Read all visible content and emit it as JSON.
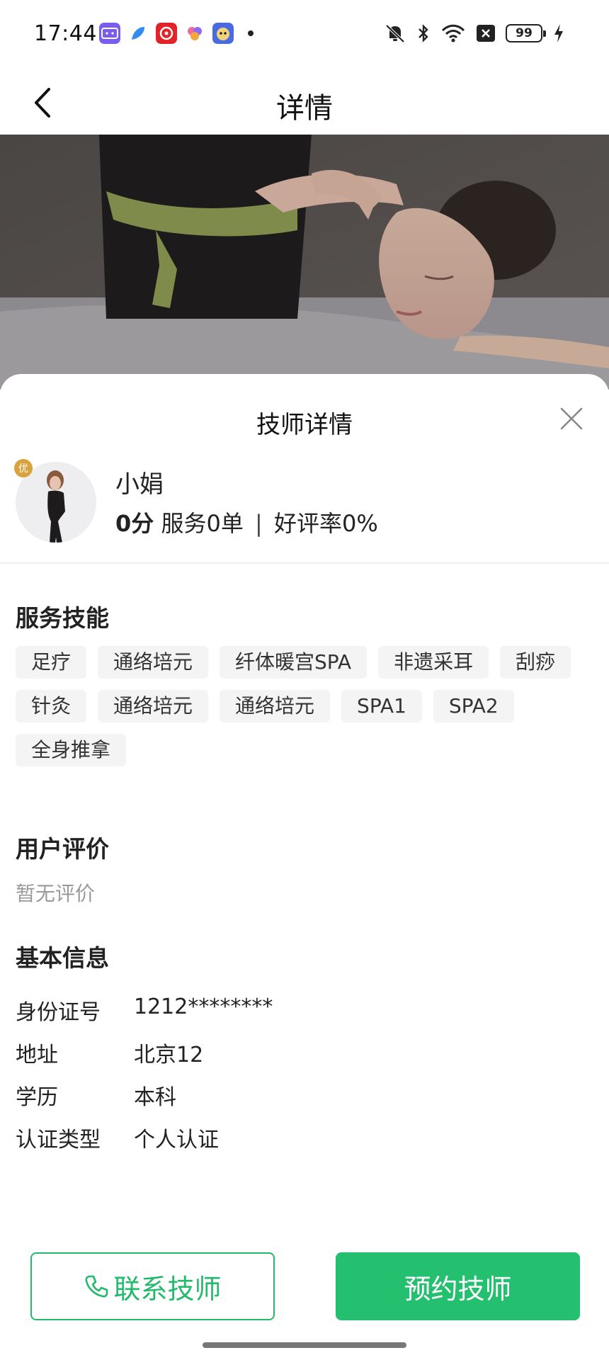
{
  "status_bar": {
    "time": "17:44",
    "battery": "99",
    "apps": [
      "bilibili-app-icon",
      "feather-app-icon",
      "netease-music-app-icon",
      "flower-app-icon",
      "game-app-icon"
    ],
    "system_icons": [
      "mute-icon",
      "bluetooth-icon",
      "wifi-icon",
      "close-box-icon",
      "battery-icon",
      "charging-icon"
    ]
  },
  "header": {
    "title": "详情",
    "back_icon": "chevron-left-icon"
  },
  "sheet": {
    "title": "技师详情",
    "close_icon": "close-icon",
    "technician": {
      "name": "小娟",
      "score": "0分",
      "orders": "服务0单",
      "separator": "|",
      "rating": "好评率0%",
      "badge": "优"
    },
    "skills": {
      "title": "服务技能",
      "tags": [
        "足疗",
        "通络培元",
        "纤体暖宫SPA",
        "非遗采耳",
        "刮痧",
        "针灸",
        "通络培元",
        "通络培元",
        "SPA1",
        "SPA2",
        "全身推拿"
      ]
    },
    "reviews": {
      "title": "用户评价",
      "empty_text": "暂无评价"
    },
    "basic_info": {
      "title": "基本信息",
      "rows": [
        {
          "label": "身份证号",
          "value": "1212********"
        },
        {
          "label": "地址",
          "value": "北京12"
        },
        {
          "label": "学历",
          "value": "本科"
        },
        {
          "label": "认证类型",
          "value": "个人认证"
        }
      ]
    }
  },
  "actions": {
    "contact_label": "联系技师",
    "contact_icon": "phone-icon",
    "book_label": "预约技师"
  },
  "colors": {
    "accent": "#22bb6b",
    "accent_fill": "#24c06f",
    "tag_bg": "#f4f4f5",
    "muted_text": "#9a9a9a"
  }
}
